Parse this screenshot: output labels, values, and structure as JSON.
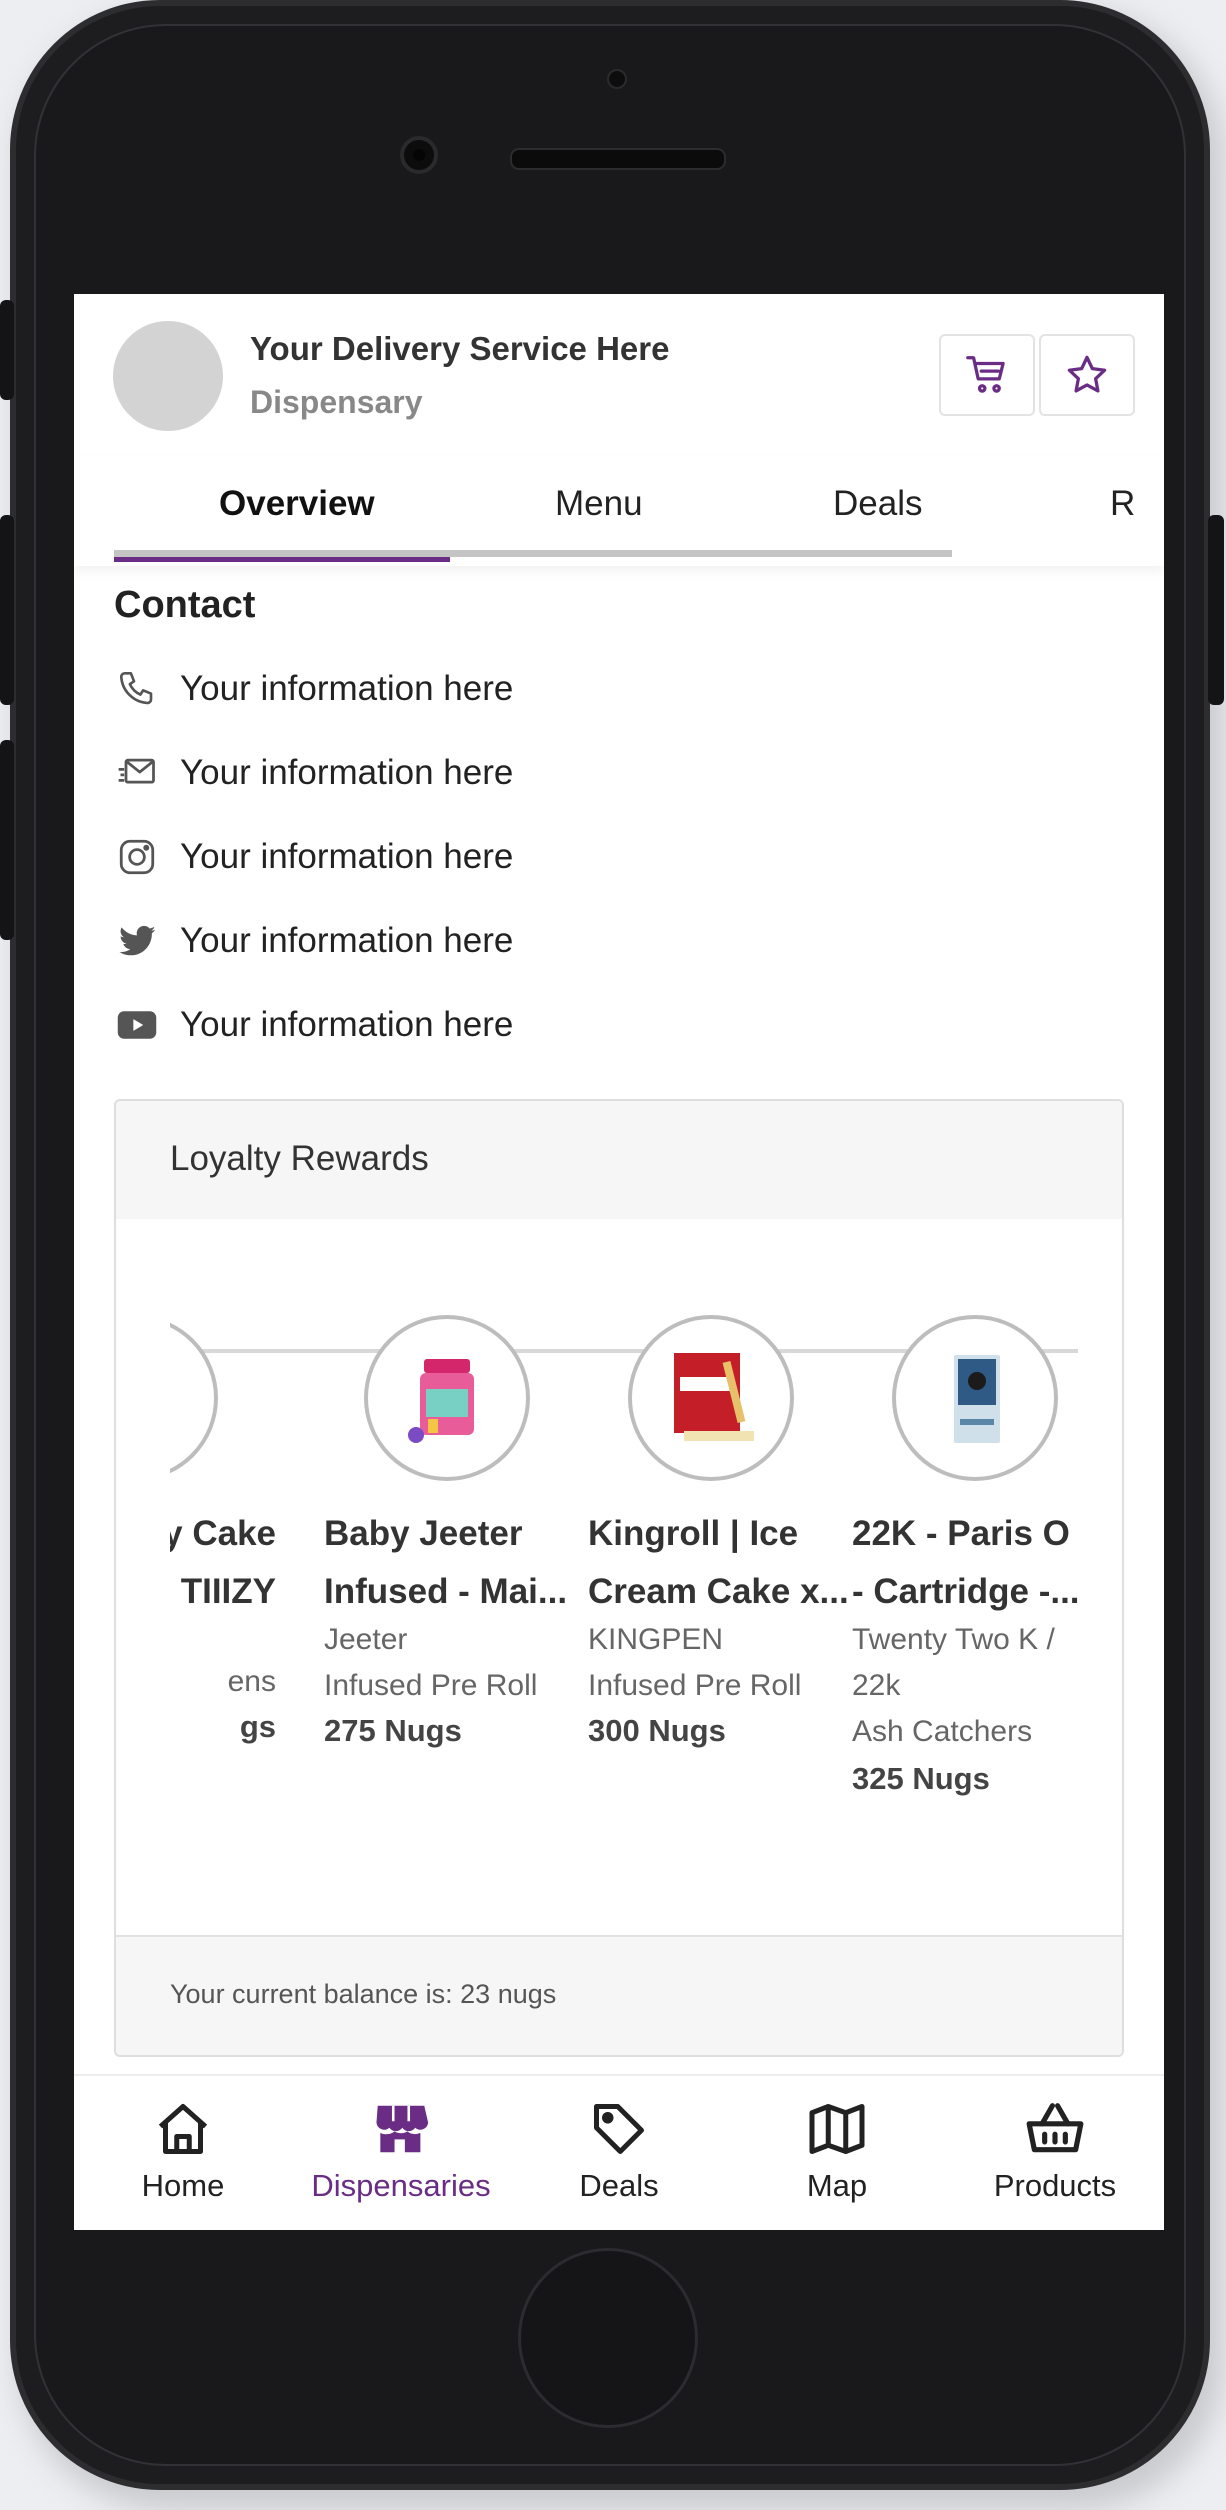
{
  "header": {
    "business_name": "Your Delivery Service Here",
    "business_type": "Dispensary",
    "cart_icon": "cart-icon",
    "favorite_icon": "star-icon"
  },
  "tabs": [
    {
      "label": "Overview",
      "active": true
    },
    {
      "label": "Menu",
      "active": false
    },
    {
      "label": "Deals",
      "active": false
    },
    {
      "label": "R",
      "active": false
    }
  ],
  "contact": {
    "title": "Contact",
    "rows": [
      {
        "icon": "phone-icon",
        "text": "Your information here"
      },
      {
        "icon": "email-icon",
        "text": "Your information here"
      },
      {
        "icon": "instagram-icon",
        "text": "Your information here"
      },
      {
        "icon": "twitter-icon",
        "text": "Your information here"
      },
      {
        "icon": "youtube-icon",
        "text": "Your information here"
      }
    ]
  },
  "loyalty": {
    "title": "Loyalty Rewards",
    "items": [
      {
        "name1": "ay Cake",
        "name2": "TIIIZY",
        "meta1": "",
        "meta2": "ens",
        "points": "gs"
      },
      {
        "name1": "Baby Jeeter",
        "name2": "Infused - Mai...",
        "meta1": "Jeeter",
        "meta2": "Infused Pre Roll",
        "points": "275 Nugs"
      },
      {
        "name1": "Kingroll | Ice",
        "name2": "Cream Cake x...",
        "meta1": "KINGPEN",
        "meta2": "Infused Pre Roll",
        "points": "300 Nugs"
      },
      {
        "name1": "22K - Paris O",
        "name2": "- Cartridge -...",
        "meta1": "Twenty Two K /",
        "meta2": "22k",
        "meta3": "Ash Catchers",
        "points": "325 Nugs"
      }
    ],
    "balance_text": "Your current balance is: 23 nugs"
  },
  "bottom_nav": [
    {
      "label": "Home",
      "icon": "home-icon",
      "active": false
    },
    {
      "label": "Dispensaries",
      "icon": "store-icon",
      "active": true
    },
    {
      "label": "Deals",
      "icon": "tag-icon",
      "active": false
    },
    {
      "label": "Map",
      "icon": "map-icon",
      "active": false
    },
    {
      "label": "Products",
      "icon": "basket-icon",
      "active": false
    }
  ],
  "colors": {
    "accent": "#6a2c84",
    "text": "#222222",
    "muted": "#888888"
  }
}
